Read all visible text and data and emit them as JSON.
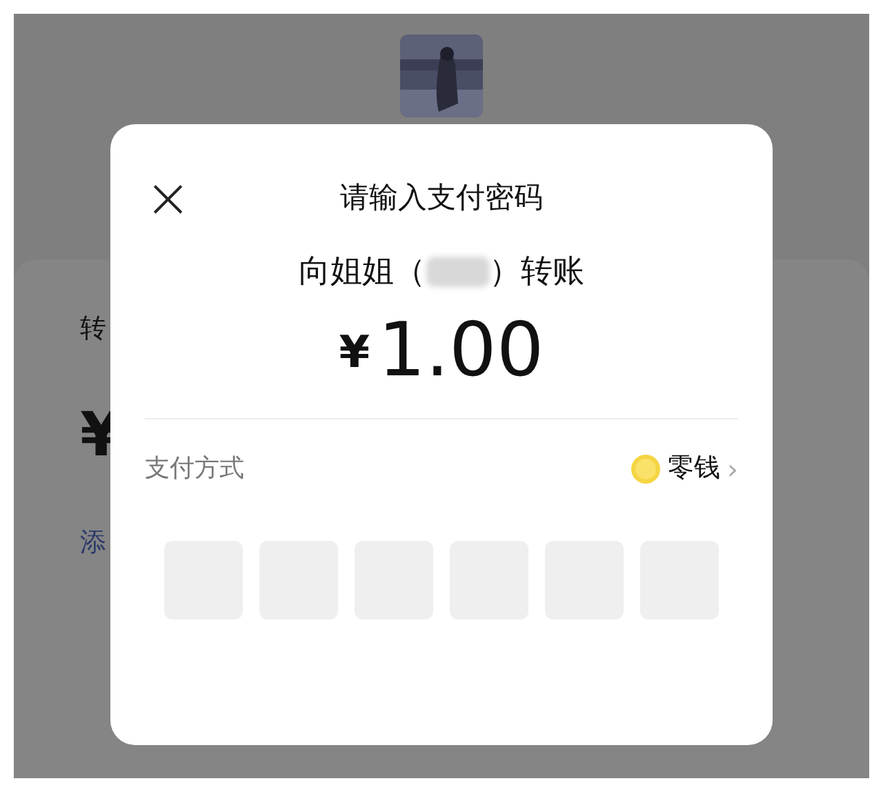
{
  "background": {
    "texts": [
      {
        "kind": "label",
        "text": "转"
      },
      {
        "kind": "amount",
        "text": "¥"
      },
      {
        "kind": "link",
        "text": "添"
      }
    ]
  },
  "dialog": {
    "close": "×",
    "title": "请输入支付密码",
    "payee_before": "向姐姐（",
    "payee_after": "）转账",
    "currency": "¥",
    "amount": "1.00",
    "method_label": "支付方式",
    "method_value": "零钱",
    "method_arrow": "›",
    "pin_slots": [
      {
        "filled": false
      },
      {
        "filled": false
      },
      {
        "filled": false
      },
      {
        "filled": false
      },
      {
        "filled": false
      },
      {
        "filled": false
      }
    ]
  }
}
